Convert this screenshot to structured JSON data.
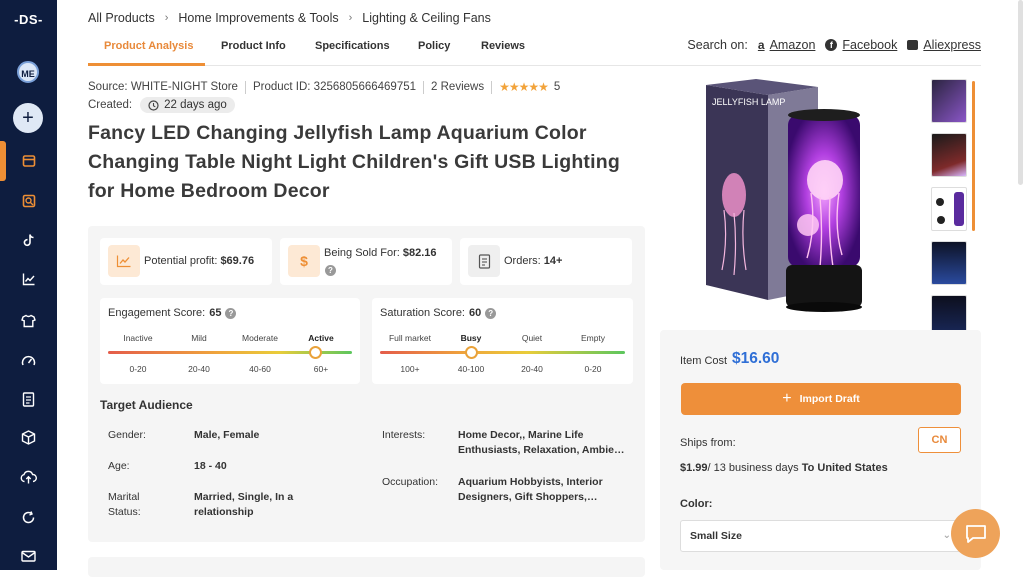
{
  "app": {
    "logo": "-DS-",
    "avatar": "ME"
  },
  "sidebar": {
    "items": [
      "box-icon",
      "search-box-icon",
      "tiktok-icon",
      "chart-icon",
      "shirt-icon",
      "gauge-icon",
      "document-icon",
      "package-icon",
      "cloud-upload-icon",
      "refresh-icon",
      "mail-icon"
    ]
  },
  "breadcrumb": [
    "All Products",
    "Home Improvements & Tools",
    "Lighting & Ceiling Fans"
  ],
  "tabs": [
    "Product Analysis",
    "Product Info",
    "Specifications",
    "Policy",
    "Reviews"
  ],
  "search_on": {
    "label": "Search on:",
    "links": [
      "Amazon",
      "Facebook",
      "Aliexpress"
    ]
  },
  "meta": {
    "source": "Source: WHITE-NIGHT Store",
    "product_id": "Product ID: 3256805666469751",
    "reviews": "2 Reviews",
    "rating": "5",
    "created_label": "Created:",
    "created_value": "22 days ago"
  },
  "product": {
    "title": "Fancy LED Changing Jellyfish Lamp Aquarium Color Changing Table Night Light Children's Gift USB Lighting for Home Bedroom Decor"
  },
  "stats": {
    "profit_label": "Potential profit:",
    "profit_value": "$69.76",
    "sold_label": "Being Sold For:",
    "sold_value": "$82.16",
    "orders_label": "Orders:",
    "orders_value": "14+"
  },
  "engagement": {
    "title": "Engagement Score:",
    "score": "65",
    "levels": [
      "Inactive",
      "Mild",
      "Moderate",
      "Active"
    ],
    "ranges": [
      "0-20",
      "20-40",
      "40-60",
      "60+"
    ],
    "level": 0.85
  },
  "saturation": {
    "title": "Saturation Score:",
    "score": "60",
    "levels": [
      "Full market",
      "Busy",
      "Quiet",
      "Empty"
    ],
    "ranges": [
      "100+",
      "40-100",
      "20-40",
      "0-20"
    ],
    "level": 0.375
  },
  "audience": {
    "title": "Target Audience",
    "gender_label": "Gender:",
    "gender_value": "Male, Female",
    "age_label": "Age:",
    "age_value": "18 - 40",
    "marital_label": "Marital Status:",
    "marital_value": "Married, Single, In a relationship",
    "interests_label": "Interests:",
    "interests_value": "Home Decor,, Marine Life Enthusiasts, Relaxation, Ambie…",
    "occupation_label": "Occupation:",
    "occupation_value": "Aquarium Hobbyists, Interior Designers, Gift Shoppers,…"
  },
  "gallery": {
    "box_text": "JELLYFISH LAMP"
  },
  "buy": {
    "cost_label": "Item Cost",
    "cost_value": "$16.60",
    "import_label": "Import Draft",
    "ships_label": "Ships from:",
    "ships_country": "CN",
    "ship_price": "$1.99",
    "ship_days": "/ 13 business days",
    "ship_to": "To United States",
    "color_label": "Color:",
    "color_value": "Small Size"
  },
  "colors": {
    "accent": "#ee8f35",
    "sidebar": "#0e1d3f",
    "price": "#2f6fd6"
  }
}
